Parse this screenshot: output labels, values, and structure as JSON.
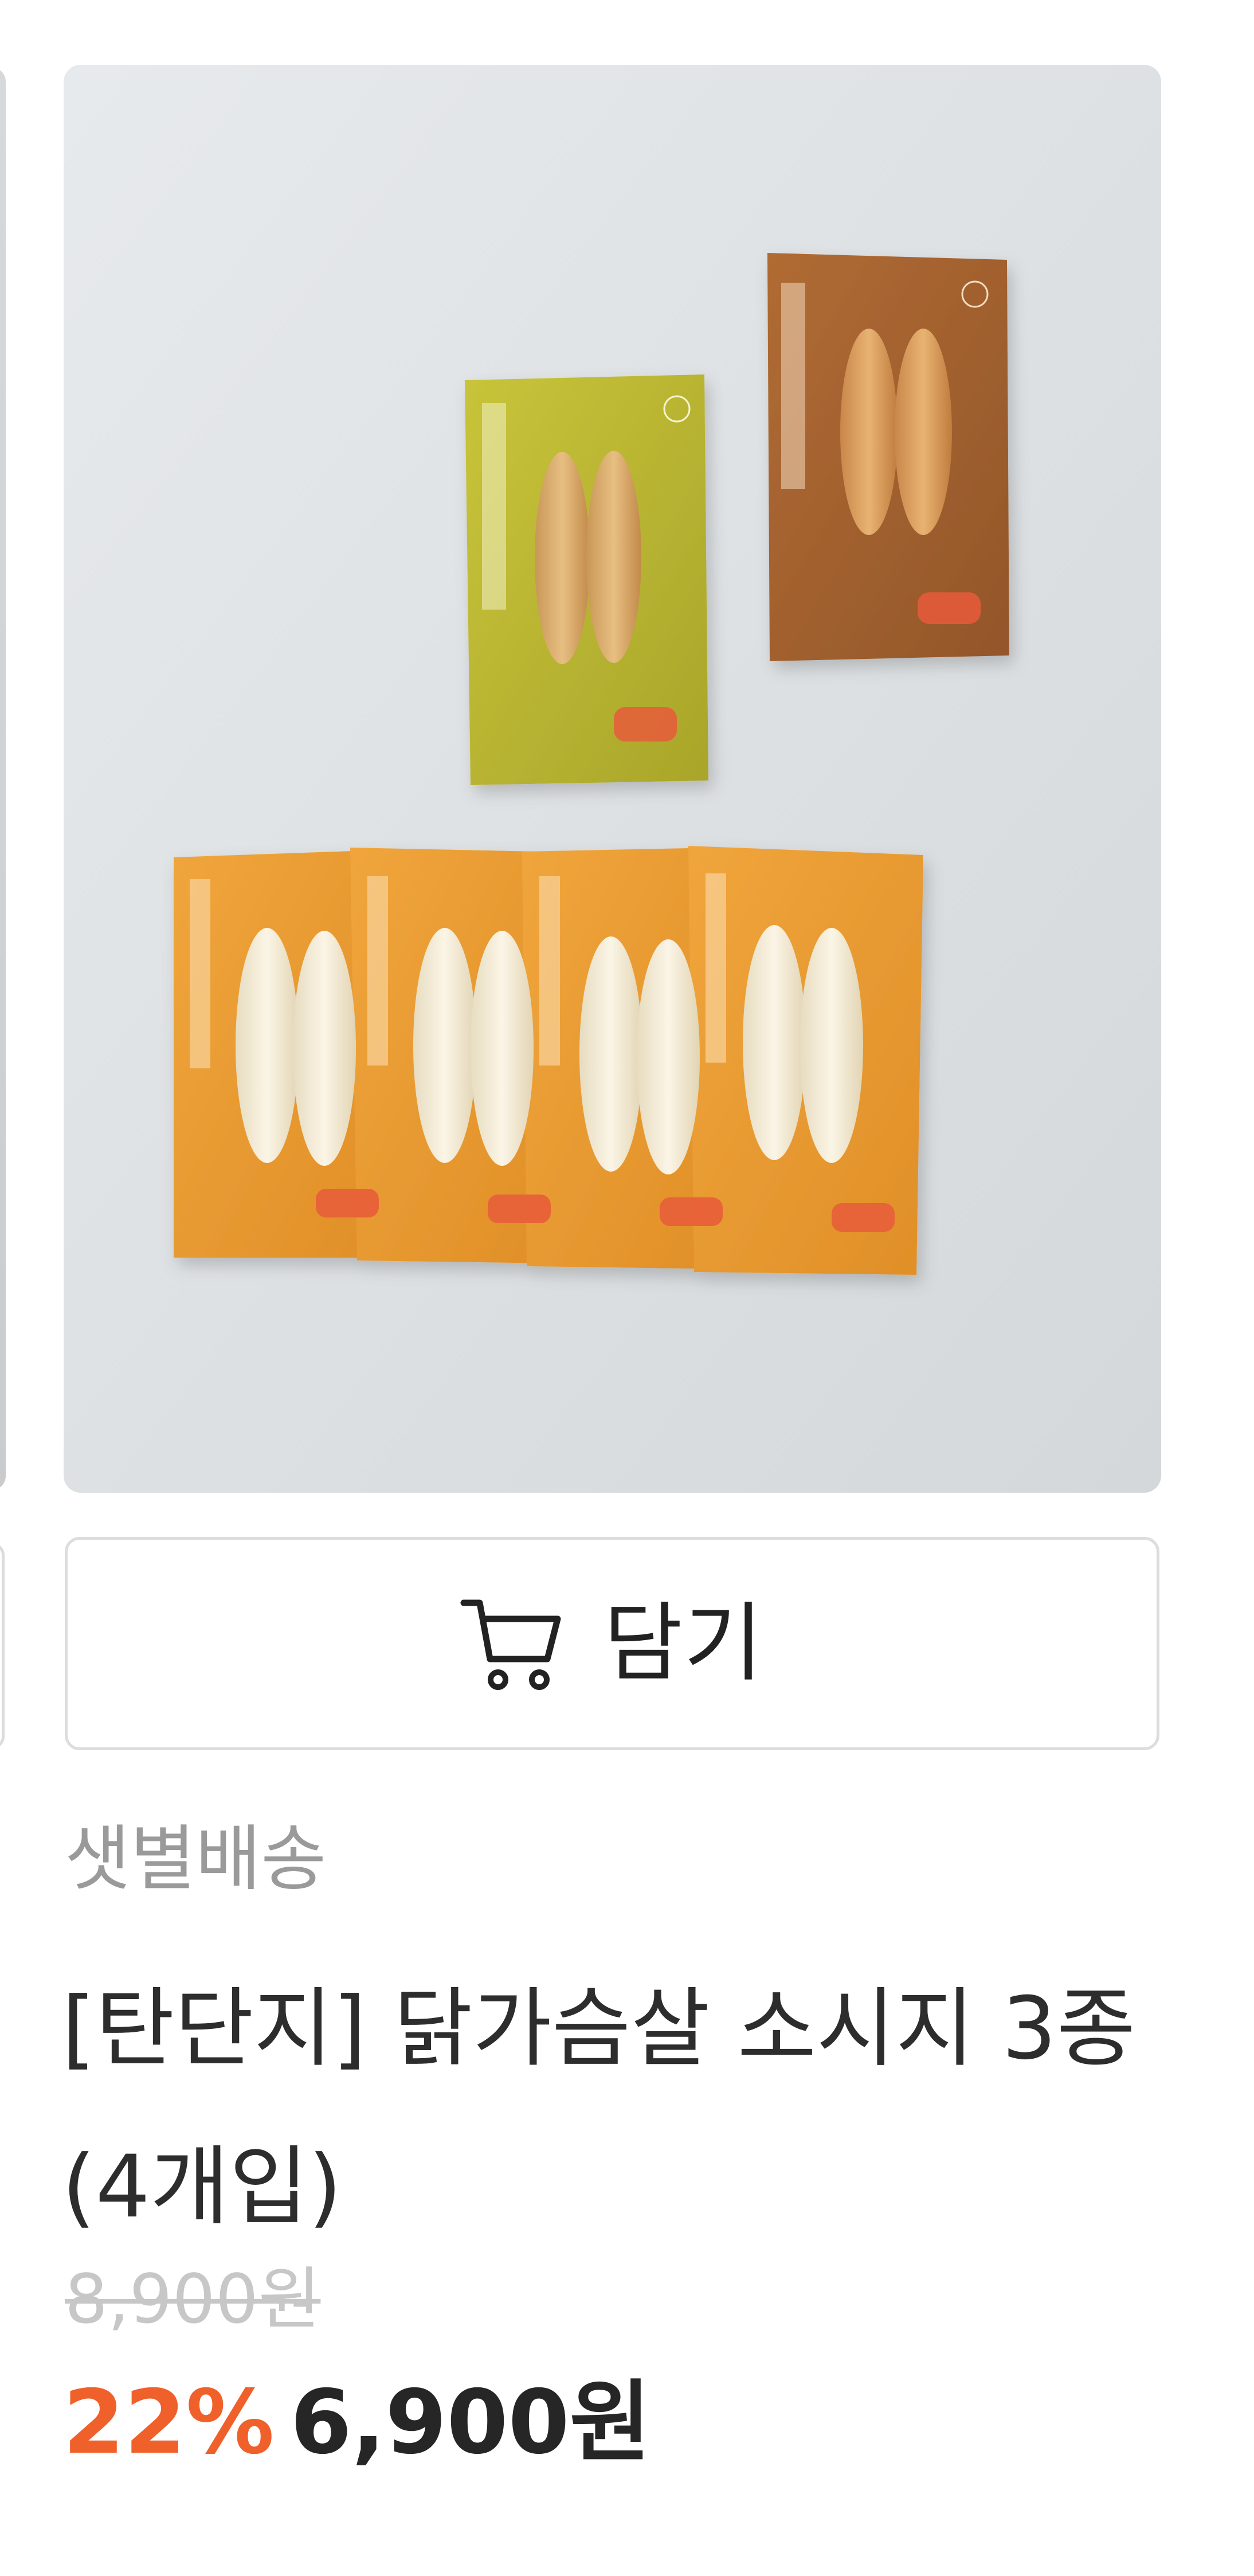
{
  "product": {
    "image_alt": "닭가슴살 소시지 3종 상품 이미지",
    "cart_button_label": "담기",
    "delivery_tag": "샛별배송",
    "title": "[탄단지] 닭가슴살 소시지 3종 (4개입)",
    "original_price": "8,900원",
    "discount_rate": "22%",
    "sale_price": "6,900원"
  },
  "icons": {
    "cart": "cart-icon"
  },
  "colors": {
    "discount": "#f0602a",
    "price": "#262626",
    "delivery_tag": "#9a9a9a",
    "original_price": "#c7c7c7",
    "button_border": "#dddddd"
  }
}
